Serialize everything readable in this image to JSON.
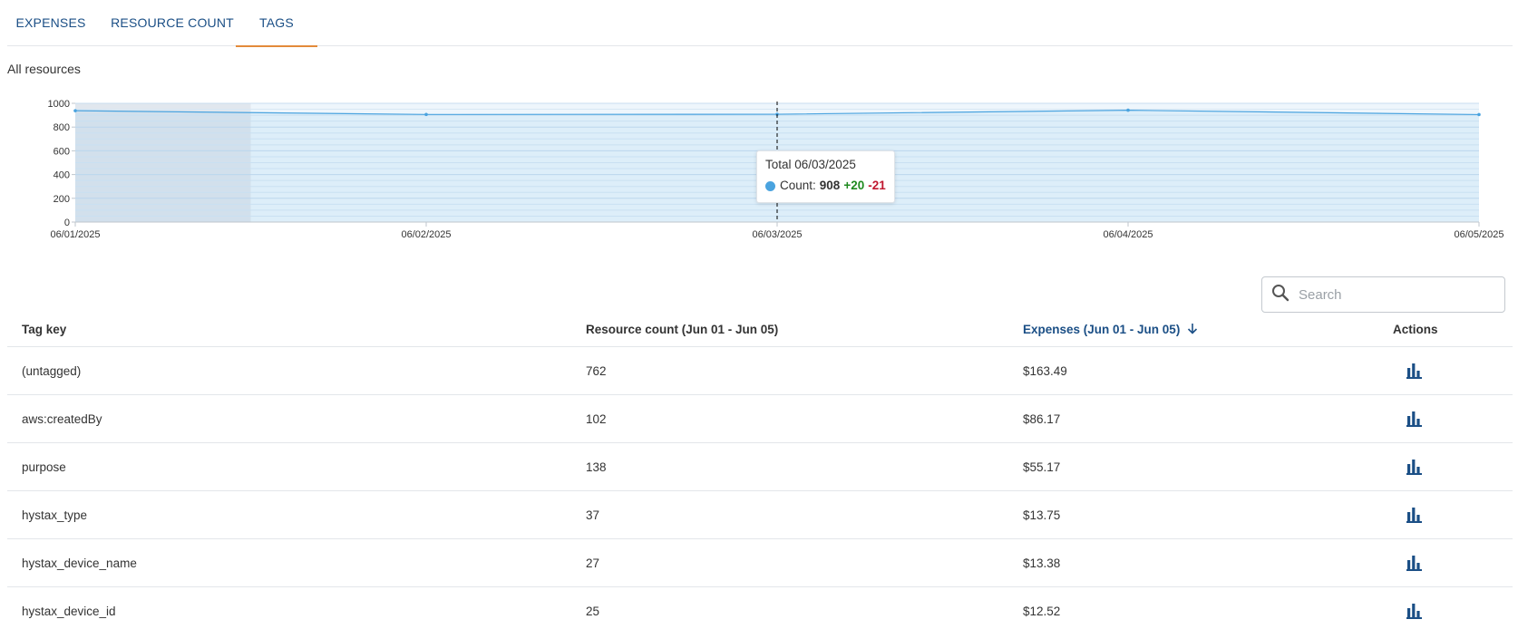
{
  "tabs": [
    {
      "label": "EXPENSES",
      "active": false
    },
    {
      "label": "RESOURCE COUNT",
      "active": false
    },
    {
      "label": "TAGS",
      "active": true
    }
  ],
  "section_title": "All resources",
  "chart_data": {
    "type": "area",
    "x": [
      "06/01/2025",
      "06/02/2025",
      "06/03/2025",
      "06/04/2025",
      "06/05/2025"
    ],
    "series": [
      {
        "values": [
          938,
          906,
          908,
          942,
          905
        ]
      }
    ],
    "ylim": [
      0,
      1000
    ],
    "y_ticks": [
      0,
      200,
      400,
      600,
      800,
      1000
    ],
    "grid": true,
    "accent_color": "#4aa3df",
    "highlight_range": [
      "06/01/2025",
      "06/01/2025 12:00"
    ],
    "crosshair_x": "06/03/2025"
  },
  "tooltip": {
    "title": "Total 06/03/2025",
    "label": "Count:",
    "value": "908",
    "increase": "+20",
    "decrease": "-21"
  },
  "search": {
    "placeholder": "Search",
    "value": ""
  },
  "table": {
    "columns": [
      {
        "label": "Tag key"
      },
      {
        "label": "Resource count (Jun 01 - Jun 05)"
      },
      {
        "label": "Expenses (Jun 01 - Jun 05)",
        "sorted": "desc"
      },
      {
        "label": "Actions"
      }
    ],
    "rows": [
      {
        "tag": "(untagged)",
        "count": "762",
        "expenses": "$163.49"
      },
      {
        "tag": "aws:createdBy",
        "count": "102",
        "expenses": "$86.17"
      },
      {
        "tag": "purpose",
        "count": "138",
        "expenses": "$55.17"
      },
      {
        "tag": "hystax_type",
        "count": "37",
        "expenses": "$13.75"
      },
      {
        "tag": "hystax_device_name",
        "count": "27",
        "expenses": "$13.38"
      },
      {
        "tag": "hystax_device_id",
        "count": "25",
        "expenses": "$12.52"
      }
    ]
  },
  "icons": {
    "search": "search-icon",
    "sort": "arrow-down-icon",
    "action": "bar-chart-icon"
  },
  "colors": {
    "link": "#1b4f86",
    "tab_indicator": "#e38a3a",
    "series": "#4aa3df",
    "up": "#1f8a1f",
    "down": "#c0172f"
  }
}
